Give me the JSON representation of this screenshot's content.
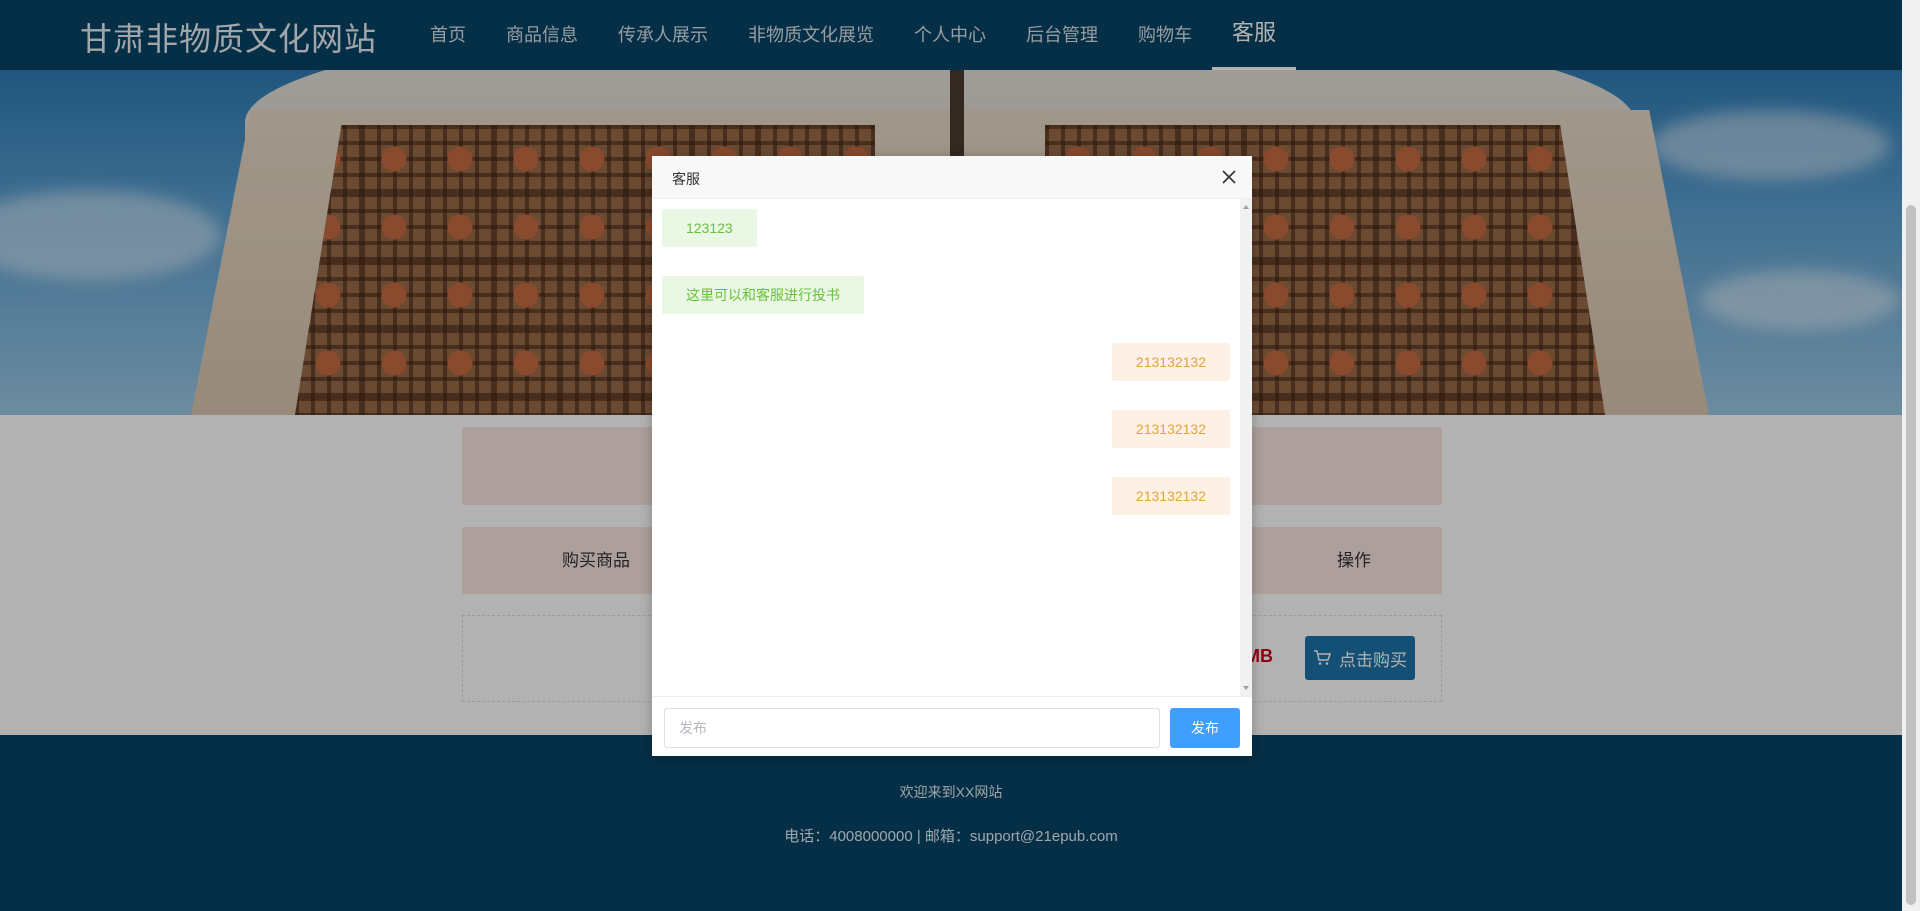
{
  "site": {
    "title": "甘肃非物质文化网站"
  },
  "nav": {
    "items": [
      {
        "label": "首页"
      },
      {
        "label": "商品信息"
      },
      {
        "label": "传承人展示"
      },
      {
        "label": "非物质文化展览"
      },
      {
        "label": "个人中心"
      },
      {
        "label": "后台管理"
      },
      {
        "label": "购物车"
      },
      {
        "label": "客服",
        "active": true
      }
    ]
  },
  "cart": {
    "columns": {
      "buy": "购买商品",
      "operation": "操作"
    },
    "price_tail": "MB",
    "buy_button": "点击购买"
  },
  "footer": {
    "welcome": "欢迎来到XX网站",
    "contact": "电话：4008000000 | 邮箱：support@21epub.com"
  },
  "chat": {
    "title": "客服",
    "messages": [
      {
        "side": "left",
        "text": "123123"
      },
      {
        "side": "left",
        "text": "这里可以和客服进行投书"
      },
      {
        "side": "right",
        "text": "213132132"
      },
      {
        "side": "right",
        "text": "213132132"
      },
      {
        "side": "right",
        "text": "213132132"
      }
    ],
    "input_placeholder": "发布",
    "send_label": "发布"
  },
  "colors": {
    "header_bg": "#074466",
    "user_bubble": "#eaf7e4",
    "service_bubble": "#fdf1e6",
    "send_button": "#409eff",
    "buy_button": "#1e72a8",
    "price": "#d0021b"
  },
  "icons": {
    "close": "close-icon",
    "cart": "cart-icon"
  }
}
